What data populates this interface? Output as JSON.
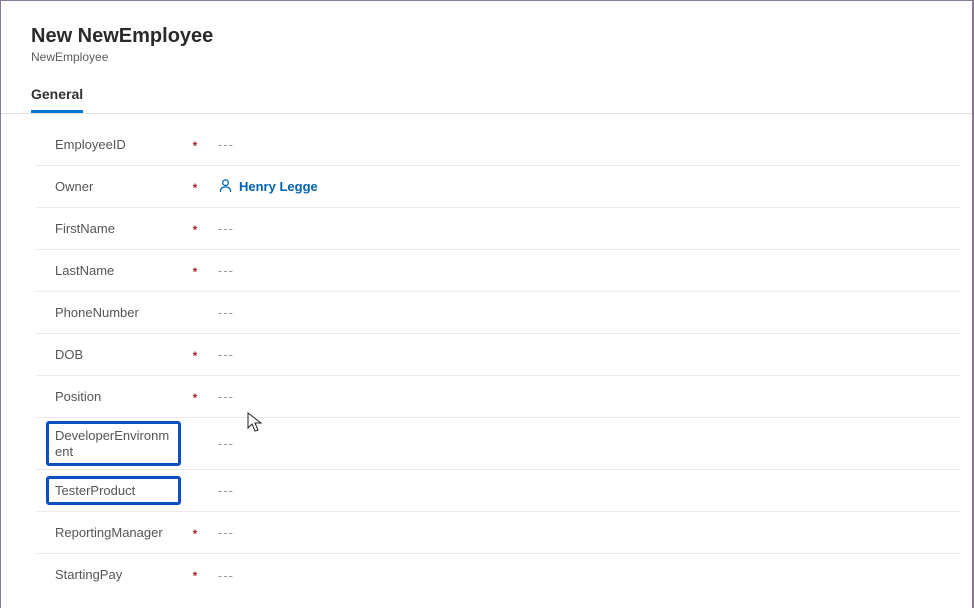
{
  "header": {
    "title": "New NewEmployee",
    "subtitle": "NewEmployee"
  },
  "tabs": {
    "general": "General"
  },
  "fields": {
    "placeholder": "---",
    "required_mark": "*",
    "employeeId": {
      "label": "EmployeeID"
    },
    "owner": {
      "label": "Owner",
      "value": "Henry Legge"
    },
    "firstName": {
      "label": "FirstName"
    },
    "lastName": {
      "label": "LastName"
    },
    "phoneNumber": {
      "label": "PhoneNumber"
    },
    "dob": {
      "label": "DOB"
    },
    "position": {
      "label": "Position"
    },
    "developerEnv": {
      "label": "DeveloperEnvironment"
    },
    "testerProduct": {
      "label": "TesterProduct"
    },
    "reportingManager": {
      "label": "ReportingManager"
    },
    "startingPay": {
      "label": "StartingPay"
    }
  }
}
